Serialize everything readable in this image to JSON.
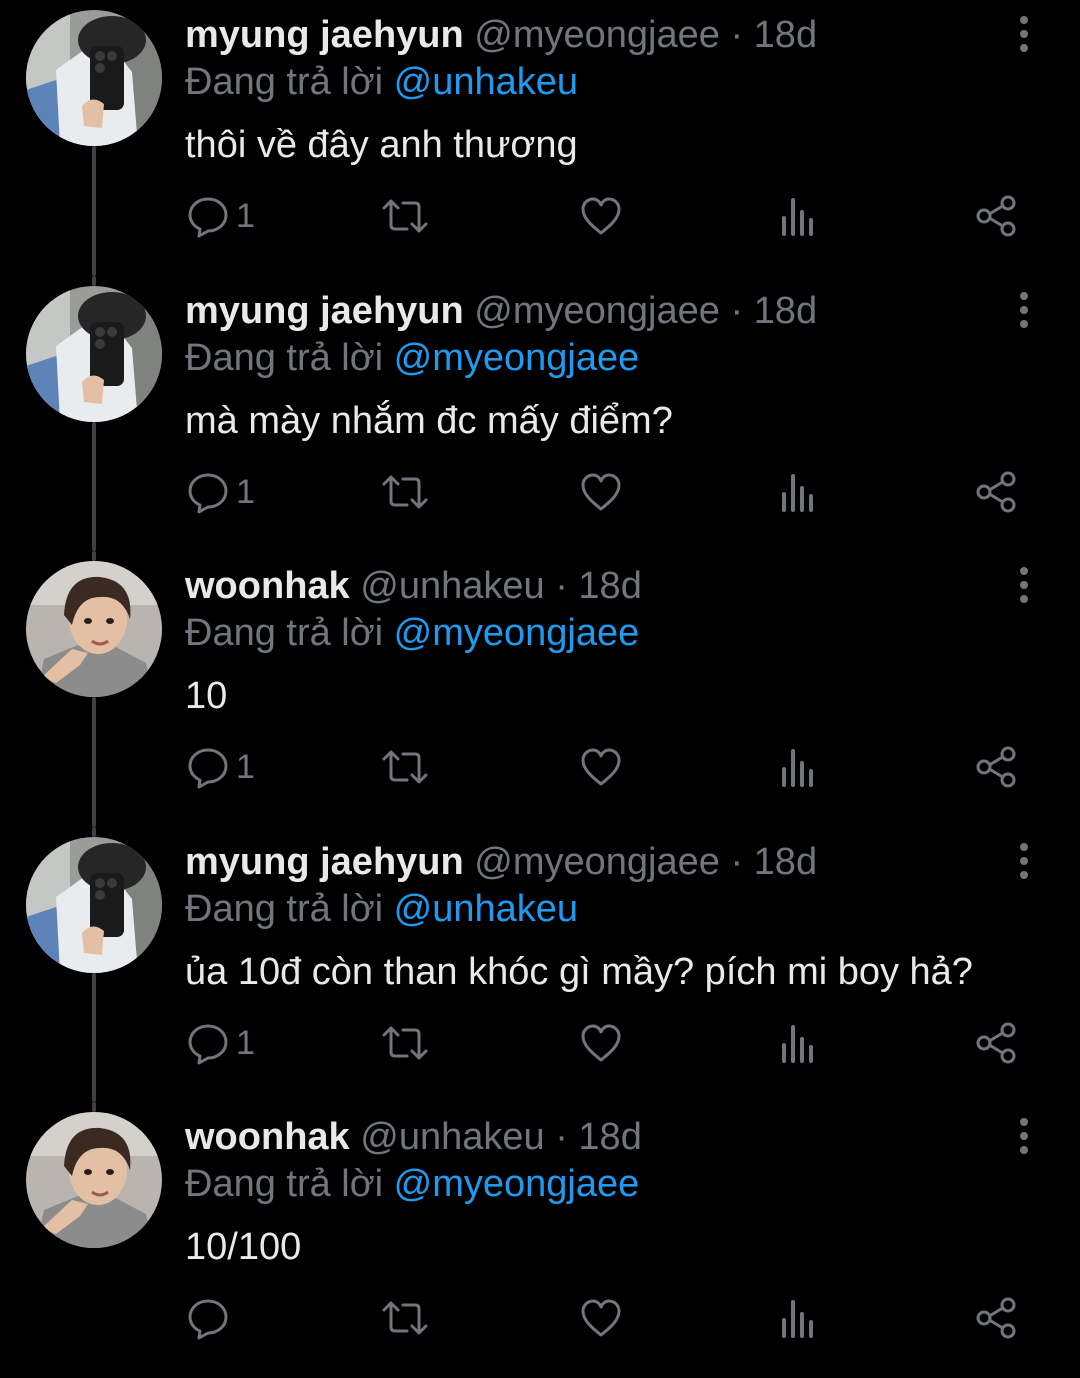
{
  "thread": {
    "reply_prefix": "Đang trả lời",
    "tweets": [
      {
        "display_name": "myung jaehyun",
        "handle": "@myeongjaee",
        "separator": "·",
        "time": "18d",
        "reply_to": "@unhakeu",
        "text": "thôi về đây anh thương",
        "reply_count": "1",
        "avatar": "avatar-myung-jaehyun"
      },
      {
        "display_name": "myung jaehyun",
        "handle": "@myeongjaee",
        "separator": "·",
        "time": "18d",
        "reply_to": "@myeongjaee",
        "text": "mà mày nhắm đc mấy điểm?",
        "reply_count": "1",
        "avatar": "avatar-myung-jaehyun"
      },
      {
        "display_name": "woonhak",
        "handle": "@unhakeu",
        "separator": "·",
        "time": "18d",
        "reply_to": "@myeongjaee",
        "text": "10",
        "reply_count": "1",
        "avatar": "avatar-woonhak"
      },
      {
        "display_name": "myung jaehyun",
        "handle": "@myeongjaee",
        "separator": "·",
        "time": "18d",
        "reply_to": "@unhakeu",
        "text": "ủa 10đ còn than khóc gì mầy? pích mi boy hả?",
        "reply_count": "1",
        "avatar": "avatar-myung-jaehyun"
      },
      {
        "display_name": "woonhak",
        "handle": "@unhakeu",
        "separator": "·",
        "time": "18d",
        "reply_to": "@myeongjaee",
        "text": "10/100",
        "reply_count": "",
        "avatar": "avatar-woonhak"
      }
    ]
  },
  "icons": {
    "reply": "reply-icon",
    "retweet": "retweet-icon",
    "like": "heart-icon",
    "views": "views-icon",
    "share": "share-icon",
    "more": "more-vertical-icon"
  },
  "colors": {
    "background": "#000000",
    "primary_text": "#e7e9ea",
    "secondary_text": "#71767b",
    "link": "#1d9bf0",
    "thread_line": "#3e4144"
  }
}
